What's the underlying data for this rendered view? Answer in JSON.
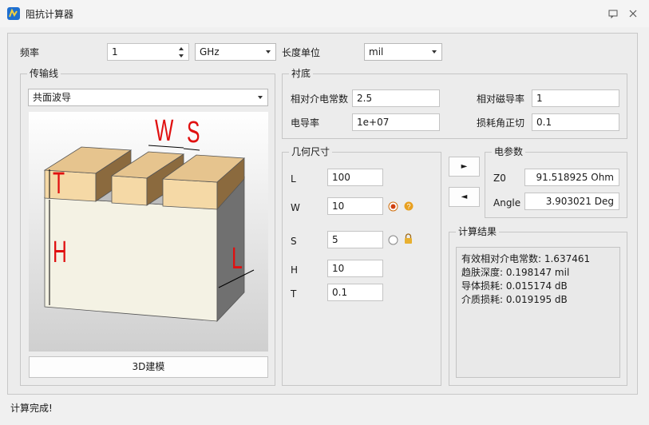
{
  "window": {
    "title": "阻抗计算器"
  },
  "top_row": {
    "frequency_label": "频率",
    "frequency_value": "1",
    "frequency_unit": "GHz",
    "length_unit_label": "长度单位",
    "length_unit_value": "mil"
  },
  "transmission_line": {
    "group_title": "传输线",
    "type_value": "共面波导",
    "diagram_labels": {
      "w": "W",
      "s": "S",
      "t": "T",
      "h": "H",
      "l": "L"
    },
    "model_button": "3D建模"
  },
  "substrate": {
    "group_title": "衬底",
    "er_label": "相对介电常数",
    "er_value": "2.5",
    "ur_label": "相对磁导率",
    "ur_value": "1",
    "cond_label": "电导率",
    "cond_value": "1e+07",
    "tand_label": "损耗角正切",
    "tand_value": "0.1"
  },
  "geometry": {
    "group_title": "几何尺寸",
    "l_label": "L",
    "l_value": "100",
    "w_label": "W",
    "w_value": "10",
    "s_label": "S",
    "s_value": "5",
    "h_label": "H",
    "h_value": "10",
    "t_label": "T",
    "t_value": "0.1"
  },
  "buttons": {
    "forward": "►",
    "back": "◄"
  },
  "electrical": {
    "group_title": "电参数",
    "z0_label": "Z0",
    "z0_value": "91.518925  Ohm",
    "angle_label": "Angle",
    "angle_value": "3.903021  Deg"
  },
  "results": {
    "group_title": "计算结果",
    "lines": [
      "有效相对介电常数: 1.637461",
      "趋肤深度: 0.198147 mil",
      "导体损耗: 0.015174 dB",
      "介质损耗: 0.019195 dB"
    ]
  },
  "status": {
    "text": "计算完成!"
  },
  "colors": {
    "conductor_top": "#e6c48e",
    "conductor_front": "#f5d9a6",
    "conductor_side": "#8b6a3e",
    "substrate_front": "#f4f2e4",
    "substrate_side": "#707070",
    "annotation_red": "#e01010",
    "accent_orange": "#e8a020"
  }
}
